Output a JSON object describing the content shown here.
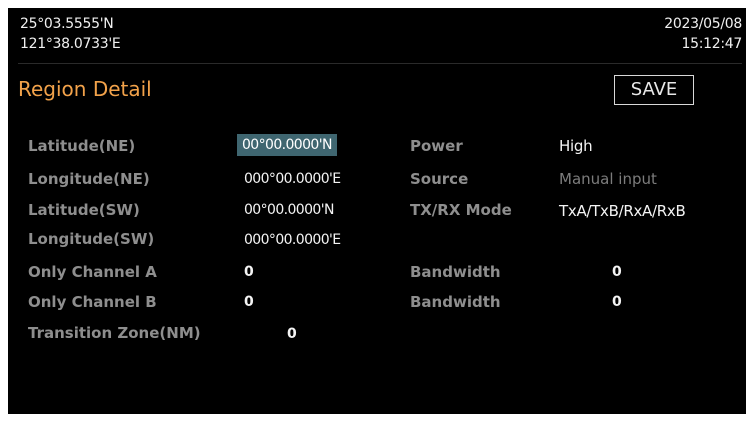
{
  "status_bar": {
    "latitude": "25°03.5555'N",
    "longitude": "121°38.0733'E",
    "date": "2023/05/08",
    "time": "15:12:47"
  },
  "header": {
    "title": "Region Detail",
    "save_label": "SAVE"
  },
  "fields": {
    "latitude_ne": {
      "label": "Latitude(NE)",
      "value": "00°00.0000'N"
    },
    "longitude_ne": {
      "label": "Longitude(NE)",
      "value": "000°00.0000'E"
    },
    "latitude_sw": {
      "label": "Latitude(SW)",
      "value": "00°00.0000'N"
    },
    "longitude_sw": {
      "label": "Longitude(SW)",
      "value": "000°00.0000'E"
    },
    "only_channel_a": {
      "label": "Only Channel A",
      "value": "0"
    },
    "only_channel_b": {
      "label": "Only Channel B",
      "value": "0"
    },
    "transition_zone": {
      "label": "Transition Zone(NM)",
      "value": "0"
    },
    "power": {
      "label": "Power",
      "value": "High"
    },
    "source": {
      "label": "Source",
      "value": "Manual input"
    },
    "txrx_mode": {
      "label": "TX/RX Mode",
      "value": "TxA/TxB/RxA/RxB"
    },
    "bandwidth_a": {
      "label": "Bandwidth",
      "value": "0"
    },
    "bandwidth_b": {
      "label": "Bandwidth",
      "value": "0"
    }
  },
  "colors": {
    "title": "#f2a24a",
    "selection": "#3f6670",
    "label": "#8e8e8e",
    "background": "#000000"
  }
}
